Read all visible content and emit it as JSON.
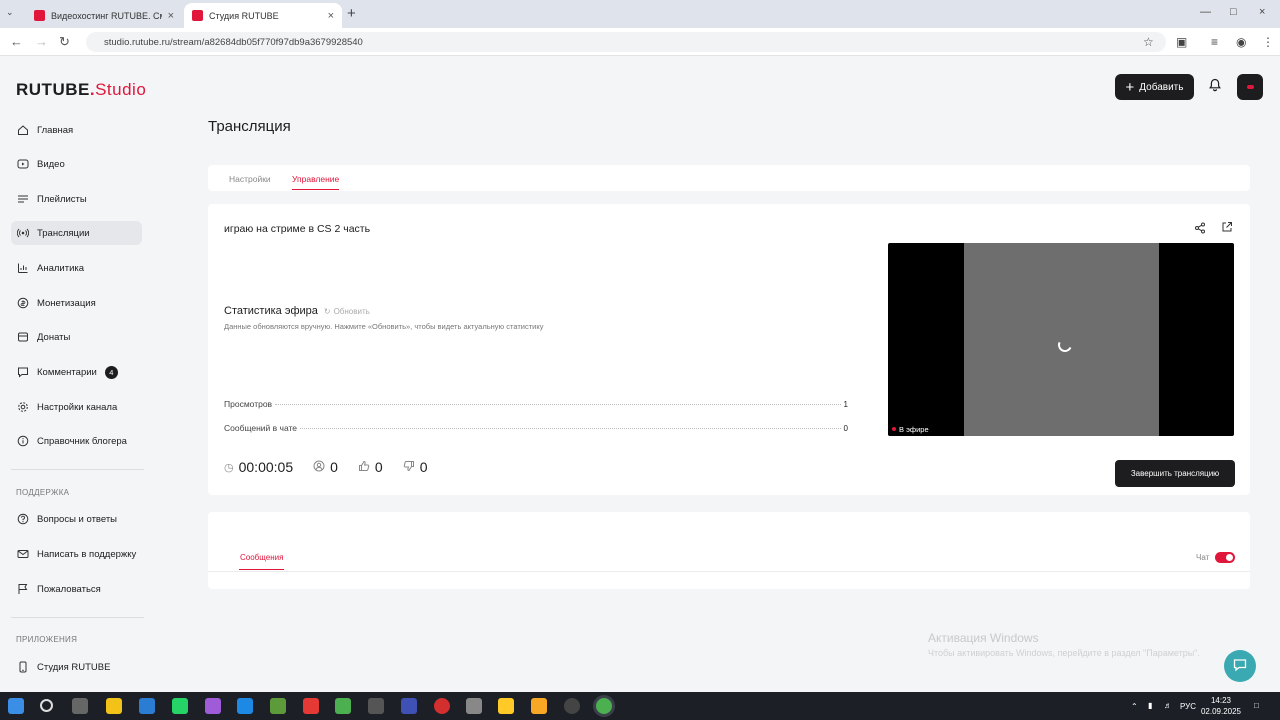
{
  "browser": {
    "tabs": [
      {
        "label": "Видеохостинг RUTUBE. Смотр..."
      },
      {
        "label": "Студия RUTUBE"
      }
    ],
    "new_tab": "+",
    "url": "studio.rutube.ru/stream/a82684db05f770f97db9a3679928540"
  },
  "app": {
    "logo": {
      "brand": "RUTUBE",
      "dot": ".",
      "suffix": "Studio"
    },
    "header": {
      "add_label": "Добавить"
    },
    "sidebar": {
      "items": [
        {
          "label": "Главная",
          "icon": "home-icon"
        },
        {
          "label": "Видео",
          "icon": "video-icon"
        },
        {
          "label": "Плейлисты",
          "icon": "playlist-icon"
        },
        {
          "label": "Трансляции",
          "icon": "broadcast-icon"
        },
        {
          "label": "Аналитика",
          "icon": "analytics-icon"
        },
        {
          "label": "Монетизация",
          "icon": "monetization-icon"
        },
        {
          "label": "Донаты",
          "icon": "donate-icon"
        },
        {
          "label": "Комментарии",
          "icon": "comments-icon",
          "badge": "4"
        },
        {
          "label": "Настройки канала",
          "icon": "gear-icon"
        },
        {
          "label": "Справочник блогера",
          "icon": "info-icon"
        }
      ],
      "support_heading": "ПОДДЕРЖКА",
      "support_items": [
        {
          "label": "Вопросы и ответы",
          "icon": "faq-icon"
        },
        {
          "label": "Написать в поддержку",
          "icon": "mail-icon"
        },
        {
          "label": "Пожаловаться",
          "icon": "flag-icon"
        }
      ],
      "apps_heading": "ПРИЛОЖЕНИЯ",
      "apps_items": [
        {
          "label": "Студия RUTUBE",
          "icon": "phone-icon"
        }
      ]
    },
    "page_title": "Трансляция",
    "page_tabs": [
      {
        "label": "Настройки"
      },
      {
        "label": "Управление",
        "active": true
      }
    ],
    "stream": {
      "title": "играю на стриме в CS 2 часть",
      "stats_heading": "Статистика эфира",
      "refresh_label": "Обновить",
      "stats_note": "Данные обновляются вручную. Нажмите «Обновить», чтобы видеть актуальную статистику",
      "stats": [
        {
          "label": "Просмотров",
          "value": "1"
        },
        {
          "label": "Сообщений в чате",
          "value": "0"
        }
      ],
      "duration": "00:00:05",
      "viewers": "0",
      "likes": "0",
      "dislikes": "0",
      "live_label": "В эфире",
      "end_button": "Завершить трансляцию"
    },
    "chat": {
      "tab_label": "Сообщения",
      "toggle_label": "Чат",
      "toggle_on": true
    },
    "watermark": {
      "title": "Активация Windows",
      "text": "Чтобы активировать Windows, перейдите в раздел \"Параметры\"."
    }
  },
  "taskbar": {
    "lang": "РУС",
    "time": "14:23",
    "date": "02.09.2025"
  },
  "colors": {
    "accent": "#e0163b",
    "dark": "#1d1d1f",
    "background": "#f4f5f7",
    "help_fab": "#3aa9b1"
  }
}
